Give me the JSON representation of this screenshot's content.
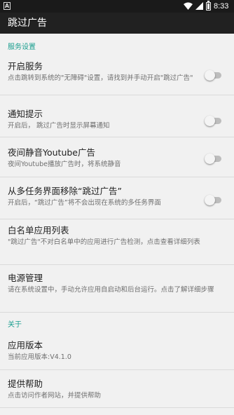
{
  "status_bar": {
    "notification_icon": "A",
    "time": "8:33",
    "icons": [
      "wifi-icon",
      "signal-icon",
      "battery-icon"
    ]
  },
  "app_bar": {
    "title": "跳过广告"
  },
  "sections": {
    "service": {
      "header": "服务设置",
      "items": [
        {
          "title": "开启服务",
          "summary": "点击跳转到系统的\"无障碍\"设置，请找到并手动开启\"跳过广告\"",
          "switch_on": false
        },
        {
          "title": "通知提示",
          "summary": "开启后， 跳过广告时显示屏幕通知",
          "switch_on": false
        },
        {
          "title": "夜间静音Youtube广告",
          "summary": "夜间Youtube播放广告时，将系统静音",
          "switch_on": false
        },
        {
          "title": "从多任务界面移除“跳过广告”",
          "summary": "开启后，“跳过广告”将不会出现在系统的多任务界面",
          "switch_on": false
        },
        {
          "title": "白名单应用列表",
          "summary": "\"跳过广告\"不对白名单中的应用进行广告检测，点击查看详细列表"
        },
        {
          "title": "电源管理",
          "summary": "请在系统设置中，手动允许应用自启动和后台运行。点击了解详细步骤"
        }
      ]
    },
    "about": {
      "header": "关于",
      "items": [
        {
          "title": "应用版本",
          "summary": "当前应用版本:V4.1.0"
        },
        {
          "title": "提供帮助",
          "summary": "点击访问作者网站，并提供帮助"
        }
      ]
    }
  },
  "colors": {
    "status_bar": "#1a1a1a",
    "app_bar": "#212121",
    "background": "#f1f1f1",
    "accent": "#1a9e8f",
    "switch_track_off": "#bdbdbd",
    "switch_thumb_off": "#f4f4f4"
  }
}
